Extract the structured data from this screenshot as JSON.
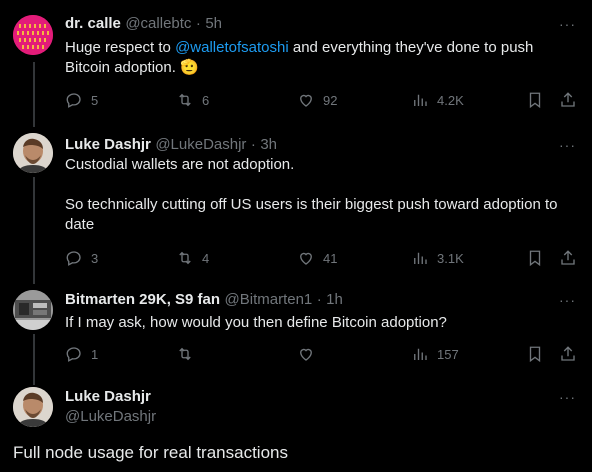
{
  "tweets": [
    {
      "name": "dr. calle",
      "handle": "@callebtc",
      "sep": "·",
      "time": "5h",
      "text_before": "Huge respect to ",
      "mention": "@walletofsatoshi",
      "text_after": " and everything they've done to push",
      "line2": "Bitcoin adoption. ",
      "emoji": "🫡",
      "replies": "5",
      "retweets": "6",
      "likes": "92",
      "views": "4.2K"
    },
    {
      "name": "Luke Dashjr",
      "handle": "@LukeDashjr",
      "sep": "·",
      "time": "3h",
      "line1": "Custodial wallets are not adoption.",
      "line2": "So technically cutting off US users is their biggest push toward adoption to",
      "line3": "date",
      "replies": "3",
      "retweets": "4",
      "likes": "41",
      "views": "3.1K"
    },
    {
      "name": "Bitmarten 29K, S9 fan",
      "handle": "@Bitmarten1",
      "sep": "·",
      "time": "1h",
      "line1": "If I may ask, how would you then define Bitcoin adoption?",
      "replies": "1",
      "retweets": "",
      "likes": "",
      "views": "157"
    }
  ],
  "main": {
    "name": "Luke Dashjr",
    "handle": "@LukeDashjr",
    "text": "Full node usage for real transactions"
  },
  "more_label": "···",
  "colors": {
    "background": "#000000",
    "text": "#e7e9ea",
    "muted": "#71767b",
    "link": "#1d9bf0"
  }
}
